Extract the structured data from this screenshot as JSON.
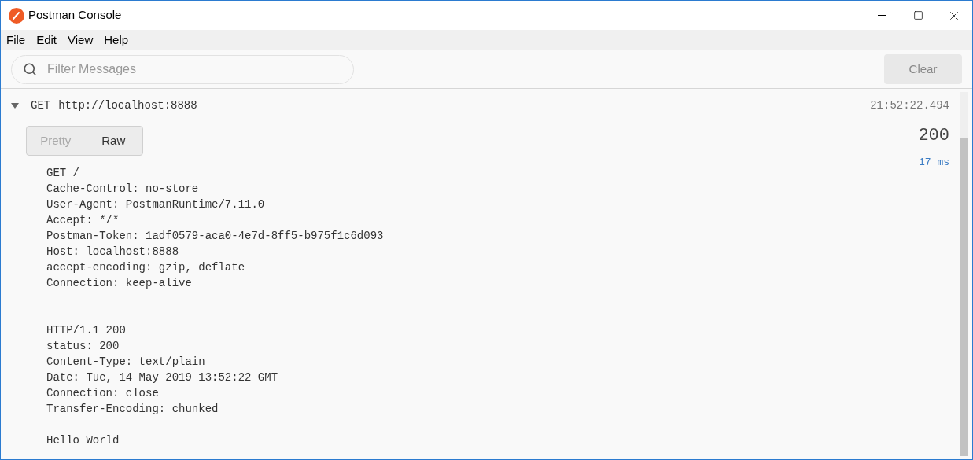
{
  "window": {
    "title": "Postman Console"
  },
  "menu": [
    "File",
    "Edit",
    "View",
    "Help"
  ],
  "filter": {
    "placeholder": "Filter Messages"
  },
  "clear_button": "Clear",
  "entry": {
    "expanded": true,
    "method": "GET",
    "url": "http://localhost:8888",
    "time": "21:52:22.494",
    "status": "200",
    "duration": "17 ms",
    "tabs": [
      {
        "label": "Pretty",
        "selected": false
      },
      {
        "label": "Raw",
        "selected": true
      }
    ],
    "request_lines": [
      "GET /",
      "Cache-Control: no-store",
      "User-Agent: PostmanRuntime/7.11.0",
      "Accept: */*",
      "Postman-Token: 1adf0579-aca0-4e7d-8ff5-b975f1c6d093",
      "Host: localhost:8888",
      "accept-encoding: gzip, deflate",
      "Connection: keep-alive"
    ],
    "response_lines": [
      "HTTP/1.1 200",
      "status: 200",
      "Content-Type: text/plain",
      "Date: Tue, 14 May 2019 13:52:22 GMT",
      "Connection: close",
      "Transfer-Encoding: chunked"
    ],
    "body_lines": [
      "Hello World"
    ]
  }
}
